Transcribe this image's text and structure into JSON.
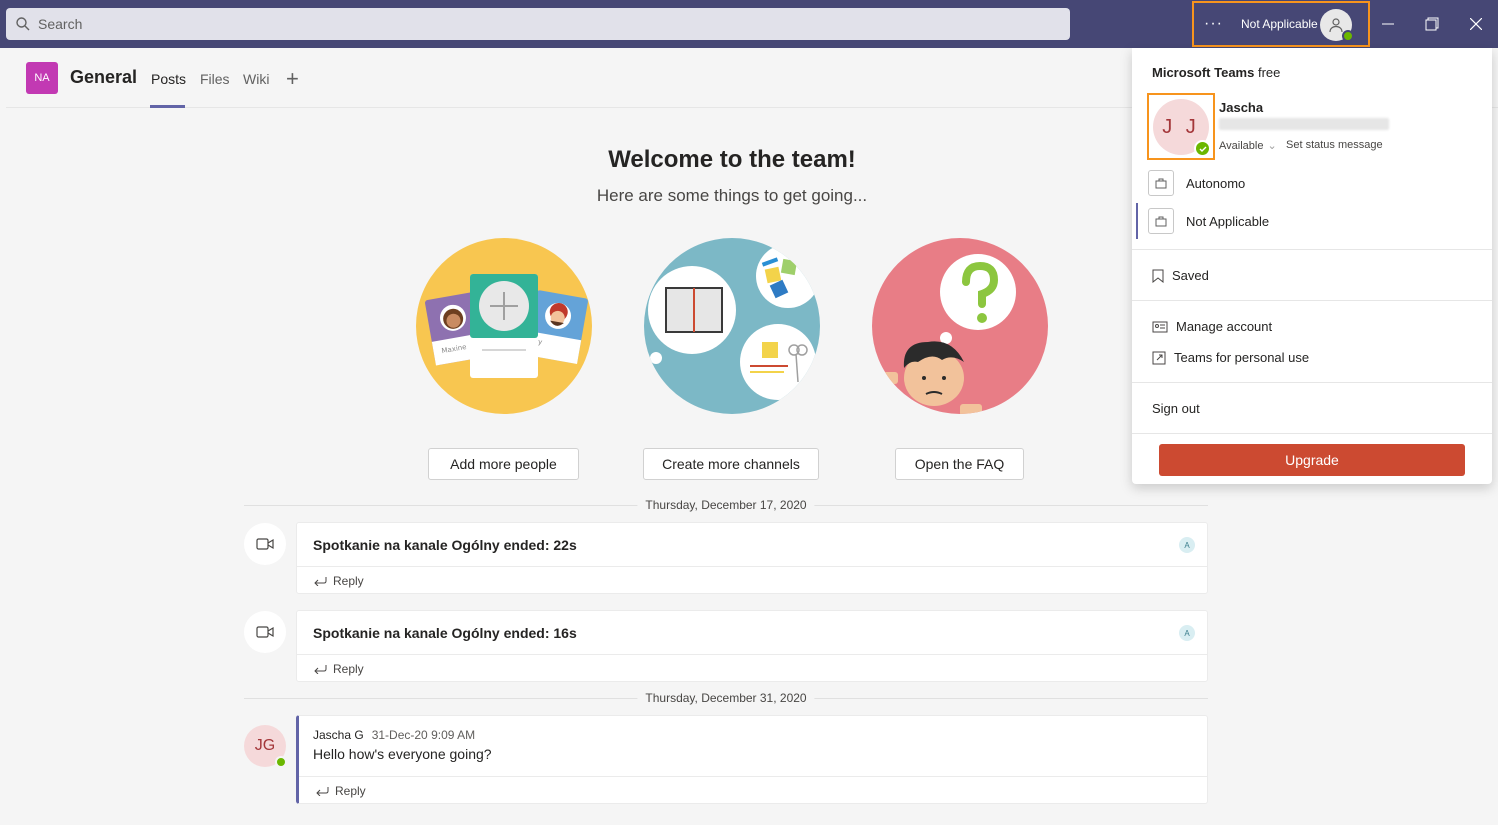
{
  "titlebar": {
    "search_placeholder": "Search",
    "more_label": "···",
    "org_name": "Not Applicable"
  },
  "channel": {
    "team_initials": "NA",
    "name": "General",
    "tabs": [
      "Posts",
      "Files",
      "Wiki"
    ],
    "add_tab": "+"
  },
  "welcome": {
    "title": "Welcome to the team!",
    "subtitle": "Here are some things to get going...",
    "actions": [
      "Add more people",
      "Create more channels",
      "Open the FAQ"
    ],
    "illustration_names": [
      "Maxine",
      "ky"
    ]
  },
  "feed": {
    "dates": [
      "Thursday, December 17, 2020",
      "Thursday, December 31, 2020"
    ],
    "meetings": [
      {
        "title": "Spotkanie na kanale Ogólny ended: 22s",
        "badge": "A",
        "reply": "Reply"
      },
      {
        "title": "Spotkanie na kanale Ogólny ended: 16s",
        "badge": "A",
        "reply": "Reply"
      }
    ],
    "post": {
      "initials": "JG",
      "author": "Jascha G",
      "time": "31-Dec-20 9:09 AM",
      "text": "Hello how's everyone going?",
      "reply": "Reply"
    }
  },
  "dropdown": {
    "brand_bold": "Microsoft Teams",
    "brand_light": "free",
    "initials": "J J",
    "name": "Jascha",
    "status": "Available",
    "status_caret": "⌄",
    "set_status": "Set status message",
    "orgs": [
      "Autonomo",
      "Not Applicable"
    ],
    "saved": "Saved",
    "manage_account": "Manage account",
    "personal_use": "Teams for personal use",
    "sign_out": "Sign out",
    "upgrade": "Upgrade"
  },
  "colors": {
    "titlebar": "#464775",
    "accent": "#6264a7",
    "highlight": "#f7941d",
    "available": "#6bb700",
    "upgrade": "#cc4a31",
    "team_avatar": "#c239b3"
  }
}
